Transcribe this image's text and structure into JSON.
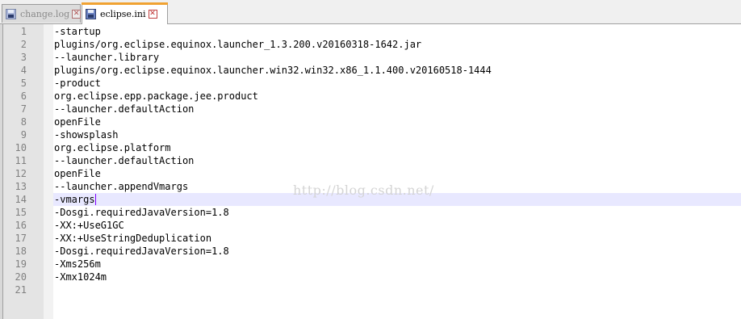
{
  "tabs": [
    {
      "label": "change.log",
      "active": false
    },
    {
      "label": "eclipse.ini",
      "active": true
    }
  ],
  "close_glyph": "✕",
  "editor": {
    "current_line": 14,
    "lines": [
      "-startup",
      "plugins/org.eclipse.equinox.launcher_1.3.200.v20160318-1642.jar",
      "--launcher.library",
      "plugins/org.eclipse.equinox.launcher.win32.win32.x86_1.1.400.v20160518-1444",
      "-product",
      "org.eclipse.epp.package.jee.product",
      "--launcher.defaultAction",
      "openFile",
      "-showsplash",
      "org.eclipse.platform",
      "--launcher.defaultAction",
      "openFile",
      "--launcher.appendVmargs",
      "-vmargs",
      "-Dosgi.requiredJavaVersion=1.8",
      "-XX:+UseG1GC",
      "-XX:+UseStringDeduplication",
      "-Dosgi.requiredJavaVersion=1.8",
      "-Xms256m",
      "-Xmx1024m",
      ""
    ]
  },
  "watermark": "http://blog.csdn.net/",
  "colors": {
    "active_tab_accent": "#f0a232",
    "current_line_bg": "#e8e8ff",
    "caret": "#8000ff"
  },
  "icons": {
    "tab_icon": "floppy-disk-icon",
    "tab_close": "close-icon"
  }
}
